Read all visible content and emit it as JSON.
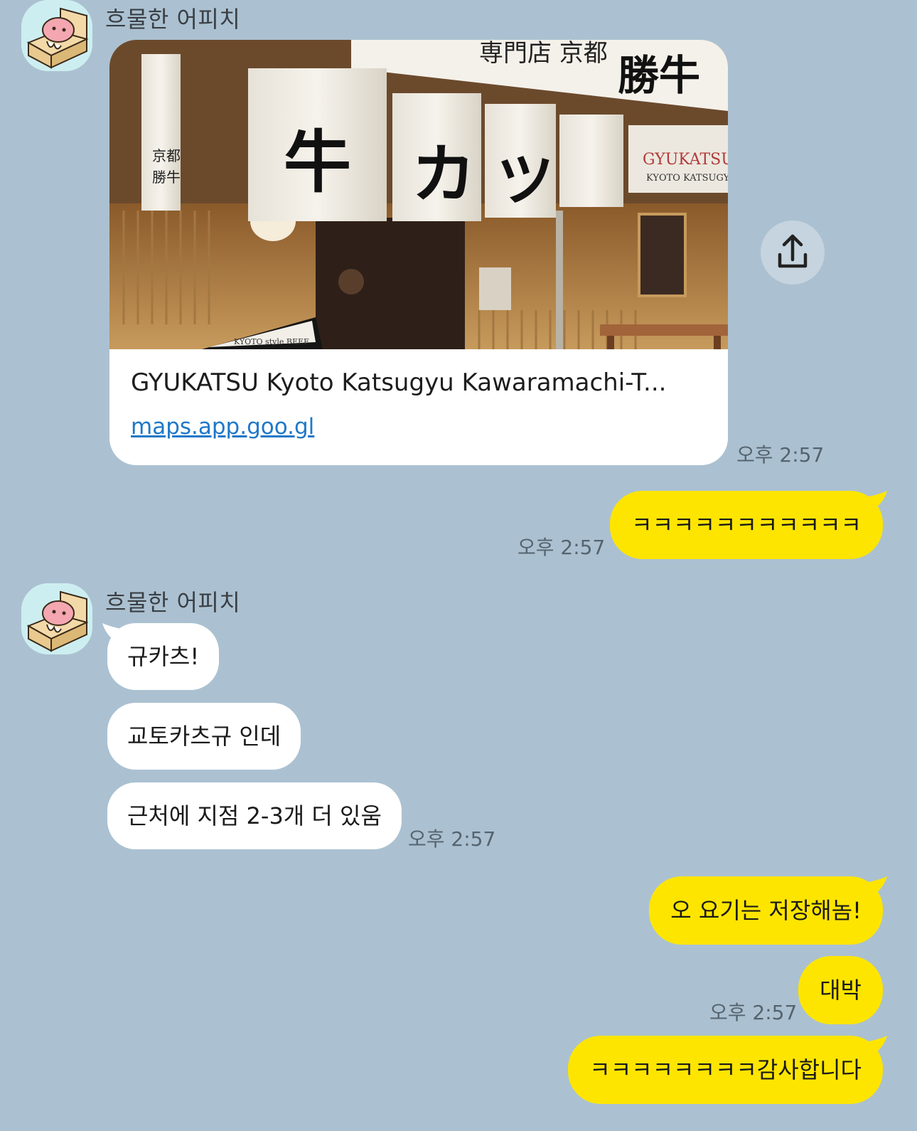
{
  "sender_name": "흐물한 어피치",
  "colors": {
    "background": "#abc1d1",
    "incoming_bubble": "#ffffff",
    "outgoing_bubble": "#fee500",
    "link": "#1e78c8"
  },
  "link_preview": {
    "title": "GYUKATSU Kyoto Katsugyu Kawaramachi-T...",
    "url": "maps.app.goo.gl",
    "image_sign_main": "牛 カ ツ",
    "image_sign_top": "専門店 京都勝牛",
    "image_sign_right": "GYUKATSU",
    "image_sign_right_sub": "KYOTO KATSUGYU",
    "image_board": "KYOTO style BEEF",
    "time": "오후 2:57"
  },
  "messages": [
    {
      "id": "out1",
      "side": "outgoing",
      "text": "ㅋㅋㅋㅋㅋㅋㅋㅋㅋㅋㅋ",
      "time": "오후 2:57"
    },
    {
      "id": "in1",
      "side": "incoming",
      "text": "규카츠!"
    },
    {
      "id": "in2",
      "side": "incoming",
      "text": "교토카츠규 인데"
    },
    {
      "id": "in3",
      "side": "incoming",
      "text": "근처에 지점 2-3개 더 있움",
      "time": "오후 2:57"
    },
    {
      "id": "out2",
      "side": "outgoing",
      "text": "오 요기는 저장해놈!"
    },
    {
      "id": "out3",
      "side": "outgoing",
      "text": "대박",
      "time": "오후 2:57"
    },
    {
      "id": "out4",
      "side": "outgoing",
      "text": "ㅋㅋㅋㅋㅋㅋㅋㅋ감사합니다"
    }
  ],
  "icons": {
    "share": "share-icon",
    "avatar": "apeach-avatar"
  }
}
